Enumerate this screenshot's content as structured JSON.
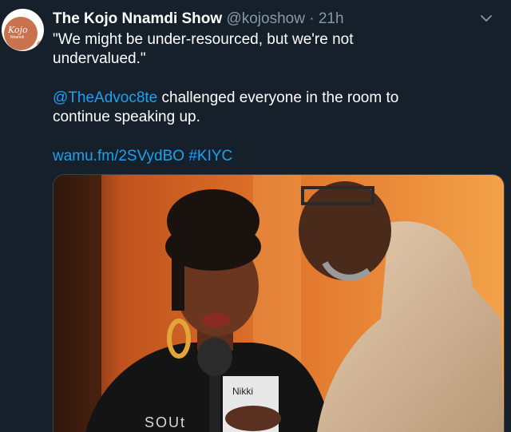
{
  "tweet": {
    "author_name": "The Kojo Nnamdi Show",
    "author_handle": "@kojoshow",
    "separator": "·",
    "timestamp": "21h",
    "quote_line1": "\"We might be under-resourced, but we're not",
    "quote_line2": "undervalued.\"",
    "mention": "@TheAdvoc8te",
    "body_line1_rest": " challenged everyone in the room to",
    "body_line2": "continue speaking up.",
    "link": "wamu.fm/2SVydBO",
    "hashtag": "#KIYC"
  },
  "avatar": {
    "logo_line1": "Kojo",
    "logo_line2": "Nnamdi"
  },
  "photo": {
    "badge_text": "Nikki",
    "shirt_text": "SOUt"
  },
  "icons": {
    "more": "chevron-down-icon"
  },
  "colors": {
    "background": "#15202b",
    "link": "#1da1f2",
    "muted": "#8899a6"
  }
}
